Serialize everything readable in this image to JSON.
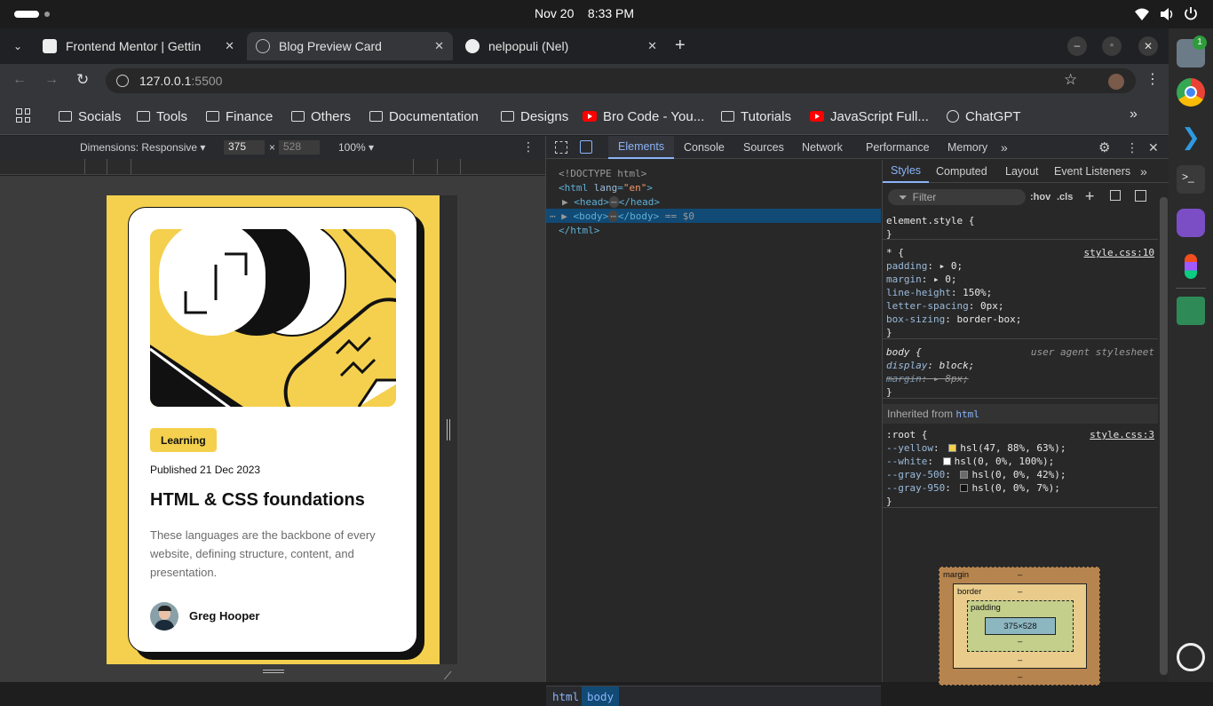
{
  "system_bar": {
    "date": "Nov 20",
    "time": "8:33 PM"
  },
  "tabs": [
    {
      "title": "Frontend Mentor | Gettin",
      "active": false
    },
    {
      "title": "Blog Preview Card",
      "active": true
    },
    {
      "title": "nelpopuli (Nel)",
      "active": false
    }
  ],
  "tab_close": "✕",
  "new_tab": "+",
  "address_bar": {
    "host": "127.0.0.1",
    "port": ":5500"
  },
  "bookmarks": [
    {
      "label": "Socials",
      "icon": "folder-icon"
    },
    {
      "label": "Tools",
      "icon": "folder-icon"
    },
    {
      "label": "Finance",
      "icon": "folder-icon"
    },
    {
      "label": "Others",
      "icon": "folder-icon"
    },
    {
      "label": "Documentation",
      "icon": "folder-icon"
    },
    {
      "label": "Designs",
      "icon": "folder-icon"
    },
    {
      "label": "Bro Code - You...",
      "icon": "youtube-icon"
    },
    {
      "label": "Tutorials",
      "icon": "folder-icon"
    },
    {
      "label": "JavaScript Full...",
      "icon": "youtube-icon"
    },
    {
      "label": "ChatGPT",
      "icon": "chatgpt-icon"
    }
  ],
  "device_toolbar": {
    "dimensions_label": "Dimensions: Responsive",
    "width": "375",
    "times": "×",
    "height": "528",
    "zoom": "100%"
  },
  "card": {
    "badge": "Learning",
    "published": "Published 21 Dec 2023",
    "title": "HTML & CSS foundations",
    "description": "These languages are the backbone of every website, defining structure, content, and presentation.",
    "author": "Greg Hooper"
  },
  "devtools": {
    "tabs": [
      "Elements",
      "Console",
      "Sources",
      "Network",
      "Performance",
      "Memory"
    ],
    "active_tab": "Elements",
    "dom": {
      "doctype": "<!DOCTYPE html>",
      "html_open": "<html",
      "lang_attr": "lang",
      "lang_val": "\"en\"",
      "head": "<head>",
      "head_close": "</head>",
      "body": "<body>",
      "body_close": "</body>",
      "selected_marker": "== $0",
      "html_close": "</html>",
      "ellipsis": "⋯"
    },
    "breadcrumbs": [
      "html",
      "body"
    ],
    "styles_tabs": [
      "Styles",
      "Computed",
      "Layout",
      "Event Listeners"
    ],
    "filter_placeholder": "Filter",
    "hov": ":hov",
    "cls": ".cls",
    "rules": {
      "element_style": "element.style {",
      "universal": {
        "selector": "* {",
        "source": "style.css:10",
        "props": [
          {
            "name": "padding",
            "value": "0;"
          },
          {
            "name": "margin",
            "value": "0;"
          },
          {
            "name": "line-height",
            "value": "150%;"
          },
          {
            "name": "letter-spacing",
            "value": "0px;"
          },
          {
            "name": "box-sizing",
            "value": "border-box;"
          }
        ]
      },
      "body": {
        "selector": "body {",
        "source": "user agent stylesheet",
        "props": [
          {
            "name": "display",
            "value": "block;"
          },
          {
            "name": "margin",
            "value": "8px;"
          }
        ]
      },
      "inherited_label": "Inherited from",
      "inherited_from": "html",
      "root": {
        "selector": ":root {",
        "source": "style.css:3",
        "props": [
          {
            "name": "--yellow",
            "value": "hsl(47, 88%, 63%);",
            "swatch": "#f4d04e"
          },
          {
            "name": "--white",
            "value": "hsl(0, 0%, 100%);",
            "swatch": "#ffffff"
          },
          {
            "name": "--gray-500",
            "value": "hsl(0, 0%, 42%);",
            "swatch": "#6b6b6b"
          },
          {
            "name": "--gray-950",
            "value": "hsl(0, 0%, 7%);",
            "swatch": "#121212"
          }
        ]
      },
      "close_brace": "}"
    },
    "box_model": {
      "margin": "margin",
      "border": "border",
      "padding": "padding",
      "content": "375×528",
      "dash": "–"
    }
  },
  "dock_badge": "1",
  "colors": {
    "accent_yellow": "#f4d04e",
    "devtools_selection": "#114a75",
    "tab_active": "#35363a"
  }
}
